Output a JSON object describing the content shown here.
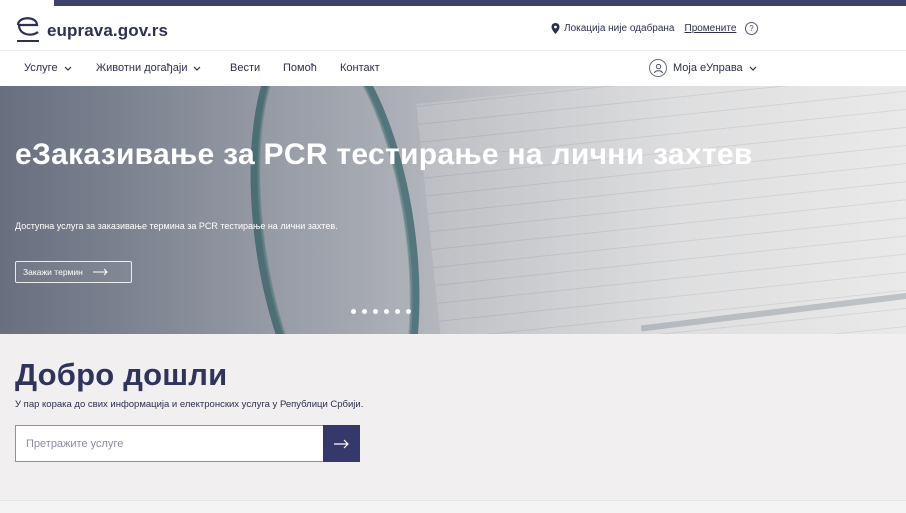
{
  "header": {
    "logo_text": "euprava.gov.rs",
    "location_text": "Локација није одабрана",
    "change_link": "Промените",
    "help_label": "?"
  },
  "nav": {
    "items": [
      {
        "label": "Услуге",
        "has_dropdown": true
      },
      {
        "label": "Животни догађаји",
        "has_dropdown": true
      },
      {
        "label": "Вести",
        "has_dropdown": false
      },
      {
        "label": "Помоћ",
        "has_dropdown": false
      },
      {
        "label": "Контакт",
        "has_dropdown": false
      }
    ],
    "account_label": "Моја еУправа"
  },
  "hero": {
    "title": "еЗаказивање за PCR тестирање на лични захтев",
    "subtitle": "Доступна услуга за заказивање термина за PCR тестирање на лични захтев.",
    "button_label": "Закажи термин",
    "slides_count": 6
  },
  "main": {
    "heading": "Добро дошли",
    "subheading": "У пар корака до свих информација и електронских услуга у Републици Србији.",
    "search_placeholder": "Претражите услуге"
  },
  "colors": {
    "brand": "#35386b",
    "background": "#f1eff0"
  }
}
